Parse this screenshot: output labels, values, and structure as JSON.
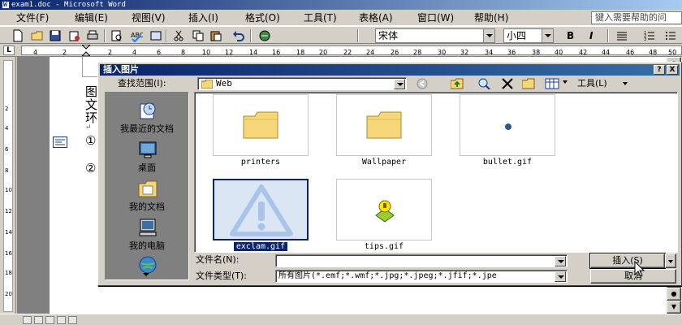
{
  "window": {
    "title": "exam1.doc - Microsoft Word"
  },
  "menu": {
    "items": [
      "文件(F)",
      "编辑(E)",
      "视图(V)",
      "插入(I)",
      "格式(O)",
      "工具(T)",
      "表格(A)",
      "窗口(W)",
      "帮助(H)"
    ],
    "help_placeholder": "键入需要帮助的问"
  },
  "toolbar": {
    "font_name": "宋体",
    "font_size": "小四",
    "bold": "B",
    "italic": "I"
  },
  "ruler": {
    "corner": "L",
    "ticks": [
      "4",
      "2",
      "2",
      "4",
      "6",
      "8",
      "10",
      "12",
      "14",
      "16",
      "18",
      "20",
      "22",
      "24",
      "26",
      "28",
      "30",
      "32",
      "34",
      "36",
      "38",
      "40",
      "42",
      "44",
      "46",
      "48",
      "50"
    ],
    "vticks": [
      "2",
      "4",
      "6",
      "8",
      "10",
      "12",
      "14",
      "16",
      "18",
      "20"
    ]
  },
  "document": {
    "chars": [
      "图",
      "文",
      "环",
      "↵",
      "①",
      "②"
    ]
  },
  "dialog": {
    "title": "插入图片",
    "help_btn": "?",
    "close_btn": "X",
    "lookin_label": "查找范围(I):",
    "lookin_value": "Web",
    "tools_label": "工具(L)",
    "places": [
      {
        "label": "我最近的文档",
        "icon": "recent-documents-icon"
      },
      {
        "label": "桌面",
        "icon": "desktop-icon"
      },
      {
        "label": "我的文档",
        "icon": "my-documents-icon"
      },
      {
        "label": "我的电脑",
        "icon": "my-computer-icon"
      },
      {
        "label": "",
        "icon": "network-places-icon"
      }
    ],
    "files": [
      {
        "name": "printers",
        "kind": "folder"
      },
      {
        "name": "Wallpaper",
        "kind": "folder"
      },
      {
        "name": "bullet.gif",
        "kind": "image"
      },
      {
        "name": "exclam.gif",
        "kind": "image",
        "selected": true
      },
      {
        "name": "tips.gif",
        "kind": "image"
      }
    ],
    "filename_label": "文件名(N):",
    "filename_value": "",
    "filetype_label": "文件类型(T):",
    "filetype_value": "所有图片(*.emf;*.wmf;*.jpg;*.jpeg;*.jfif;*.jpe",
    "insert_btn": "插入(S)",
    "cancel_btn": "取消"
  },
  "colors": {
    "title_active": "#0a246a",
    "selection": "#0a246a",
    "folder_yellow": "#f5d77a",
    "exclam_blue": "#a9c4e8"
  }
}
